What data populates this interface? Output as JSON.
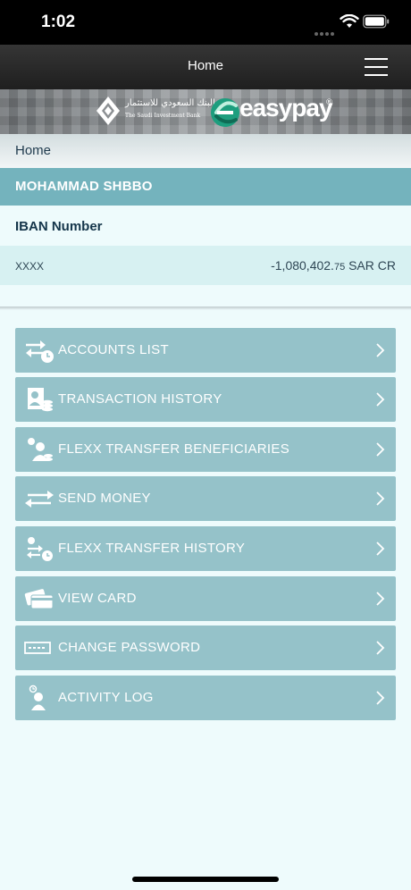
{
  "status": {
    "time": "1:02"
  },
  "nav": {
    "title": "Home"
  },
  "banner": {
    "bank_name_ar": "البنك السعودي للاستثمار",
    "bank_name_en": "The Saudi Investment Bank",
    "brand": "easypay",
    "brand_mark": "®"
  },
  "breadcrumb": {
    "current": "Home"
  },
  "customer": {
    "name": "MOHAMMAD SHBBO"
  },
  "account": {
    "iban_label": "IBAN Number",
    "number": "XXXX",
    "balance_main": "-1,080,402.",
    "balance_decimal": "75",
    "balance_suffix": " SAR CR"
  },
  "menu": [
    {
      "label": "ACCOUNTS LIST",
      "icon": "accounts-transfer-icon"
    },
    {
      "label": "TRANSACTION HISTORY",
      "icon": "transaction-history-icon"
    },
    {
      "label": "FLEXX TRANSFER BENEFICIARIES",
      "icon": "beneficiaries-icon"
    },
    {
      "label": "SEND MONEY",
      "icon": "send-money-icon"
    },
    {
      "label": "FLEXX TRANSFER HISTORY",
      "icon": "transfer-history-icon"
    },
    {
      "label": "VIEW CARD",
      "icon": "card-icon"
    },
    {
      "label": "CHANGE PASSWORD",
      "icon": "password-icon"
    },
    {
      "label": "ACTIVITY LOG",
      "icon": "activity-log-icon"
    }
  ],
  "colors": {
    "menu_bg": "#95c2c9",
    "name_bar": "#74b3bd",
    "page_bg": "#eefbfc",
    "brand_green": "#1d9e7e"
  }
}
